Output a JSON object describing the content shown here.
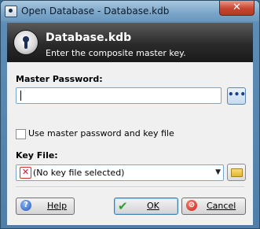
{
  "window": {
    "title": "Open Database - Database.kdb",
    "close_glyph": "✕"
  },
  "banner": {
    "title": "Database.kdb",
    "subtitle": "Enter the composite master key."
  },
  "master_password": {
    "label": "Master Password:",
    "value": "",
    "reveal_button": "•••"
  },
  "key_file_option": {
    "label": "Use master password and key file",
    "checked": false
  },
  "key_file": {
    "label": "Key File:",
    "selected": "(No key file selected)",
    "status_glyph": "✕"
  },
  "buttons": {
    "help": "Help",
    "ok": "OK",
    "cancel": "Cancel"
  },
  "icons": {
    "help": "?",
    "ok": "✔",
    "cancel": "⊘",
    "dropdown": "▼"
  },
  "colors": {
    "banner_bg": "#1a1a1a",
    "accent": "#3c7fb1"
  }
}
